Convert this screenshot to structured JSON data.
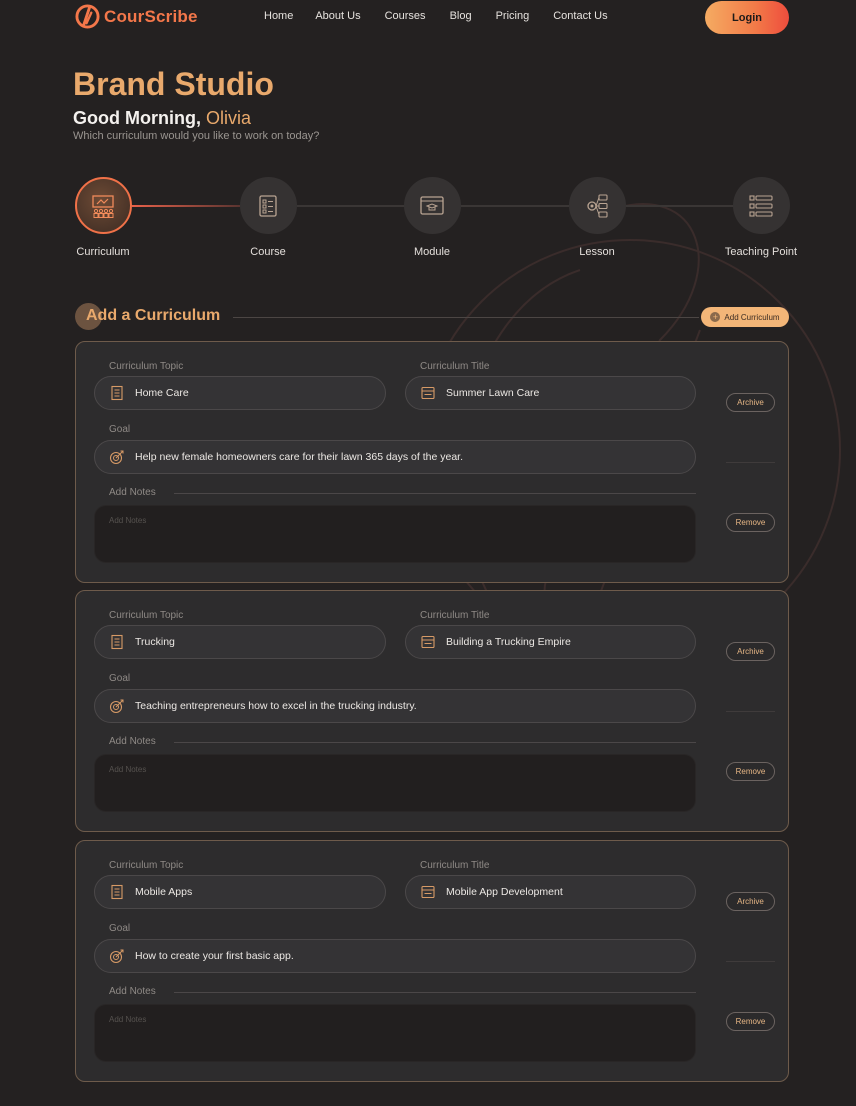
{
  "brand": {
    "name": "CourScribe",
    "accent": "#f4774a",
    "gold": "#e9a96c"
  },
  "nav": {
    "links": [
      "Home",
      "About Us",
      "Courses",
      "Blog",
      "Pricing",
      "Contact Us"
    ],
    "login_label": "Login"
  },
  "header": {
    "title": "Brand Studio",
    "greeting_prefix": "Good Morning, ",
    "user_name": "Olivia",
    "subtitle": "Which curriculum would you like to work on today?"
  },
  "stepper": {
    "steps": [
      {
        "label": "Curriculum",
        "icon": "curriculum-icon",
        "active": true
      },
      {
        "label": "Course",
        "icon": "course-icon",
        "active": false
      },
      {
        "label": "Module",
        "icon": "module-icon",
        "active": false
      },
      {
        "label": "Lesson",
        "icon": "lesson-icon",
        "active": false
      },
      {
        "label": "Teaching Point",
        "icon": "teaching-point-icon",
        "active": false
      }
    ]
  },
  "section": {
    "title": "Add a Curriculum",
    "add_button_label": "Add Curriculum"
  },
  "form_labels": {
    "topic": "Curriculum Topic",
    "title": "Curriculum  Title",
    "goal": "Goal",
    "notes": "Add Notes",
    "notes_placeholder": "Add Notes",
    "archive": "Archive",
    "remove": "Remove"
  },
  "curricula": [
    {
      "topic": "Home Care",
      "title": "Summer Lawn Care",
      "goal": "Help new female homeowners care for their lawn 365 days of the year."
    },
    {
      "topic": "Trucking",
      "title": "Building a Trucking Empire",
      "goal": "Teaching entrepreneurs how to excel in the trucking industry."
    },
    {
      "topic": "Mobile Apps",
      "title": "Mobile App Development",
      "goal": "How to create your first basic app."
    }
  ]
}
